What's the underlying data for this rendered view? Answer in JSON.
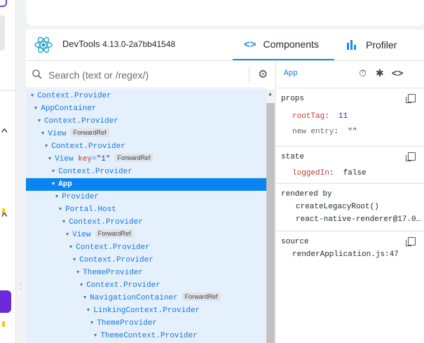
{
  "devtools": {
    "name": "DevTools",
    "version": "4.13.0-2a7bb41548",
    "tabs": [
      {
        "label": "Components",
        "icon": "code-brackets-icon",
        "active": true
      },
      {
        "label": "Profiler",
        "icon": "bar-chart-icon",
        "active": false
      }
    ]
  },
  "search": {
    "placeholder": "Search (text or /regex/)",
    "value": ""
  },
  "tree": [
    {
      "label": "Context.Provider",
      "depth": 0
    },
    {
      "label": "AppContainer",
      "depth": 1
    },
    {
      "label": "Context.Provider",
      "depth": 2
    },
    {
      "label": "View",
      "depth": 3,
      "badge": "ForwardRef"
    },
    {
      "label": "Context.Provider",
      "depth": 4
    },
    {
      "label": "View",
      "depth": 5,
      "key": "\"1\"",
      "badge": "ForwardRef"
    },
    {
      "label": "Context.Provider",
      "depth": 6
    },
    {
      "label": "App",
      "depth": 6,
      "selected": true
    },
    {
      "label": "Provider",
      "depth": 7
    },
    {
      "label": "Portal.Host",
      "depth": 8
    },
    {
      "label": "Context.Provider",
      "depth": 9
    },
    {
      "label": "View",
      "depth": 10,
      "badge": "ForwardRef"
    },
    {
      "label": "Context.Provider",
      "depth": 11
    },
    {
      "label": "Context.Provider",
      "depth": 12
    },
    {
      "label": "ThemeProvider",
      "depth": 13
    },
    {
      "label": "Context.Provider",
      "depth": 14
    },
    {
      "label": "NavigationContainer",
      "depth": 15,
      "badge": "ForwardRef"
    },
    {
      "label": "LinkingContext.Provider",
      "depth": 16
    },
    {
      "label": "ThemeProvider",
      "depth": 17
    },
    {
      "label": "ThemeContext.Provider",
      "depth": 18
    }
  ],
  "inspector": {
    "selected_name": "App",
    "props": {
      "title": "props",
      "items": [
        {
          "key": "rootTag",
          "value": "11"
        },
        {
          "key": "new entry",
          "value": "\"\""
        }
      ]
    },
    "state": {
      "title": "state",
      "items": [
        {
          "key": "loggedIn",
          "value": "false"
        }
      ]
    },
    "rendered_by": {
      "title": "rendered by",
      "items": [
        "createLegacyRoot()",
        "react-native-renderer@17.0…"
      ]
    },
    "source": {
      "title": "source",
      "value": "renderApplication.js:47"
    }
  },
  "colors": {
    "accent": "#0b84f3",
    "tree_bg": "#e4f1fd",
    "component": "#1a73d9",
    "prop_key": "#c0392b"
  }
}
